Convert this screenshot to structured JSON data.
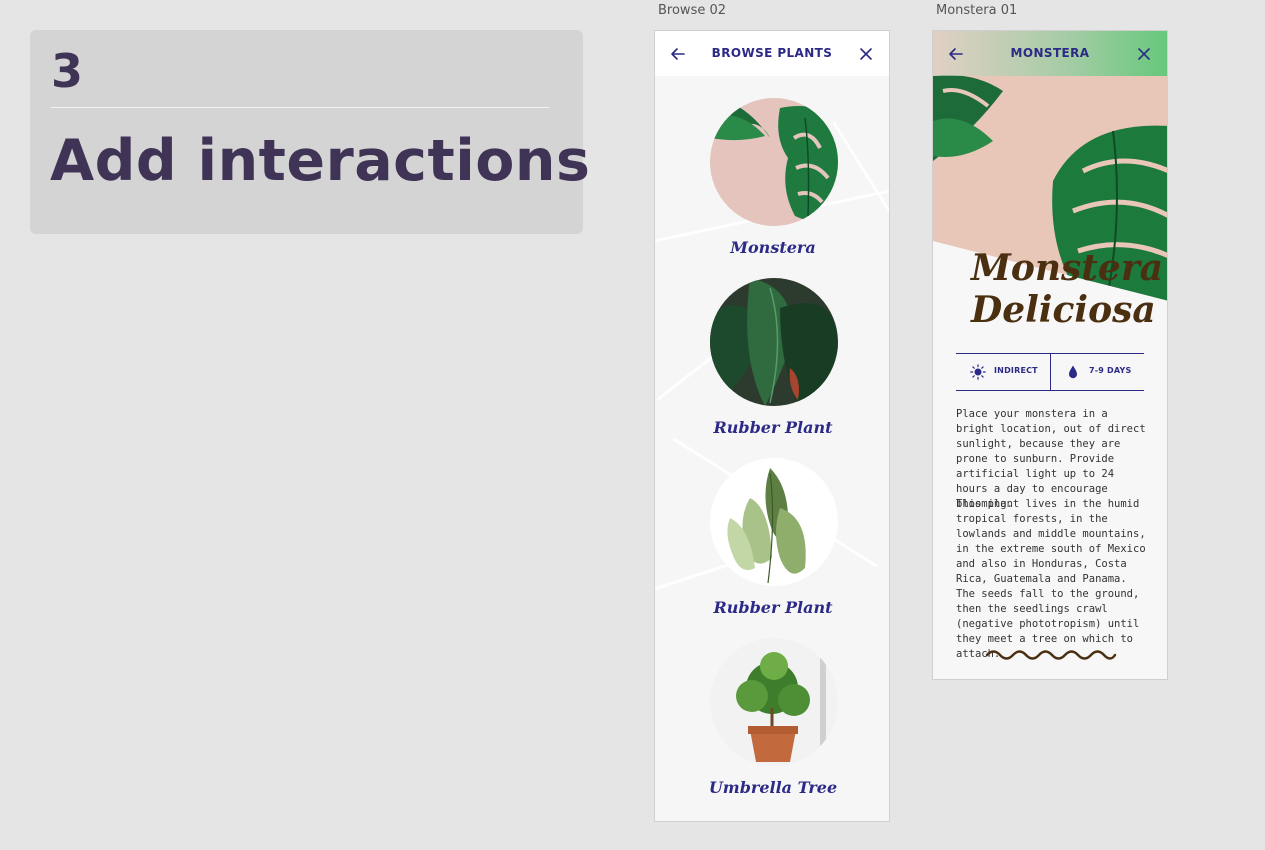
{
  "step": {
    "number": "3",
    "title": "Add interactions"
  },
  "artboards": {
    "browse_label": "Browse 02",
    "detail_label": "Monstera 01"
  },
  "browse": {
    "title": "BROWSE PLANTS",
    "plants": [
      {
        "name": "Monstera"
      },
      {
        "name": "Rubber Plant"
      },
      {
        "name": "Rubber Plant"
      },
      {
        "name": "Umbrella Tree"
      }
    ]
  },
  "detail": {
    "title": "MONSTERA",
    "heading_line1": "Monstera",
    "heading_line2": "Deliciosa",
    "light": "INDIRECT",
    "water": "7-9 DAYS",
    "paragraph1": "Place your monstera in a bright location, out of direct sunlight, because they are prone to sunburn. Provide artificial light up to 24 hours a day to encourage blooming.",
    "paragraph2": "This plant lives in the humid tropical forests, in the lowlands and middle mountains, in the extreme south of Mexico and also in Honduras, Costa Rica, Guatemala and Panama. The seeds fall to the ground, then the seedlings crawl (negative phototropism) until they meet a tree on which to attach."
  },
  "colors": {
    "accent": "#2b2a86",
    "heading": "#4a2f10",
    "step_text": "#3f3356"
  },
  "icons": [
    "arrow-left-icon",
    "close-icon",
    "sun-icon",
    "water-drop-icon",
    "squiggle-divider"
  ]
}
